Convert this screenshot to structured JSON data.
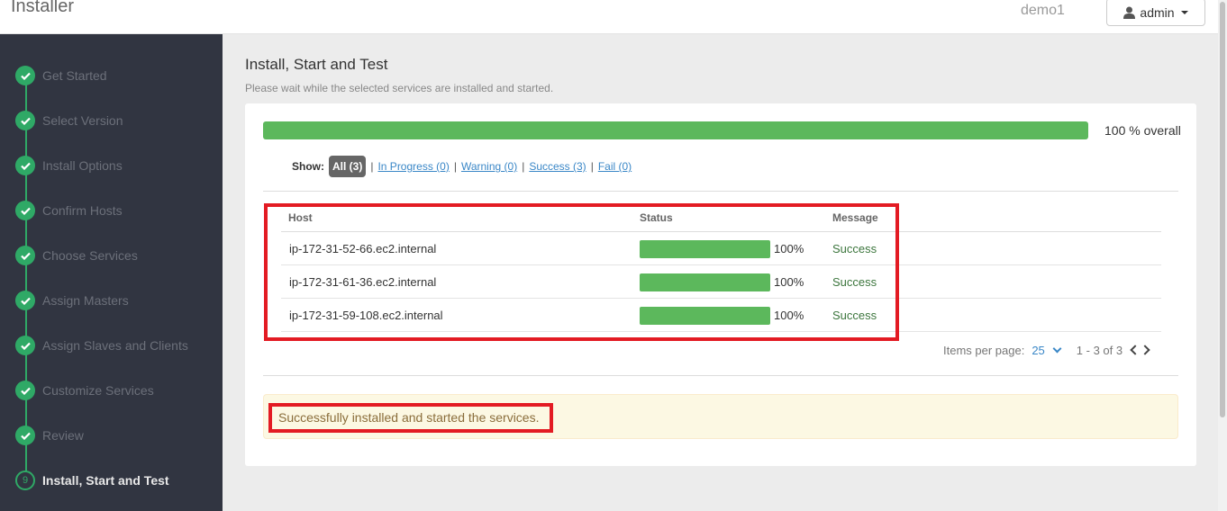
{
  "header": {
    "app_title": "Installer",
    "cluster_name": "demo1",
    "user_label": "admin",
    "user_icon": "user-icon"
  },
  "sidebar": {
    "steps": [
      {
        "label": "Get Started",
        "state": "done"
      },
      {
        "label": "Select Version",
        "state": "done"
      },
      {
        "label": "Install Options",
        "state": "done"
      },
      {
        "label": "Confirm Hosts",
        "state": "done"
      },
      {
        "label": "Choose Services",
        "state": "done"
      },
      {
        "label": "Assign Masters",
        "state": "done"
      },
      {
        "label": "Assign Slaves and Clients",
        "state": "done"
      },
      {
        "label": "Customize Services",
        "state": "done"
      },
      {
        "label": "Review",
        "state": "done"
      },
      {
        "label": "Install, Start and Test",
        "state": "current",
        "number": "9"
      }
    ]
  },
  "main": {
    "title": "Install, Start and Test",
    "subtitle": "Please wait while the selected services are installed and started.",
    "overall_progress": 100,
    "overall_label": "100 % overall",
    "filter": {
      "show_label": "Show:",
      "all": "All (3)",
      "in_progress": "In Progress (0)",
      "warning": "Warning (0)",
      "success": "Success (3)",
      "fail": "Fail (0)",
      "separator": "|"
    },
    "table": {
      "columns": [
        "Host",
        "Status",
        "Message"
      ],
      "rows": [
        {
          "host": "ip-172-31-52-66.ec2.internal",
          "progress": 100,
          "percent": "100%",
          "message": "Success"
        },
        {
          "host": "ip-172-31-61-36.ec2.internal",
          "progress": 100,
          "percent": "100%",
          "message": "Success"
        },
        {
          "host": "ip-172-31-59-108.ec2.internal",
          "progress": 100,
          "percent": "100%",
          "message": "Success"
        }
      ]
    },
    "pagination": {
      "items_per_page_label": "Items per page:",
      "items_per_page": "25",
      "range": "1 - 3 of 3"
    },
    "alert": "Successfully installed and started the services."
  },
  "colors": {
    "sidebar_bg": "#313541",
    "step_green": "#2fa966",
    "progress_green": "#5cb85c",
    "link_blue": "#3a87c7",
    "highlight_red": "#e31b23",
    "alert_bg": "#fcf8e3"
  }
}
